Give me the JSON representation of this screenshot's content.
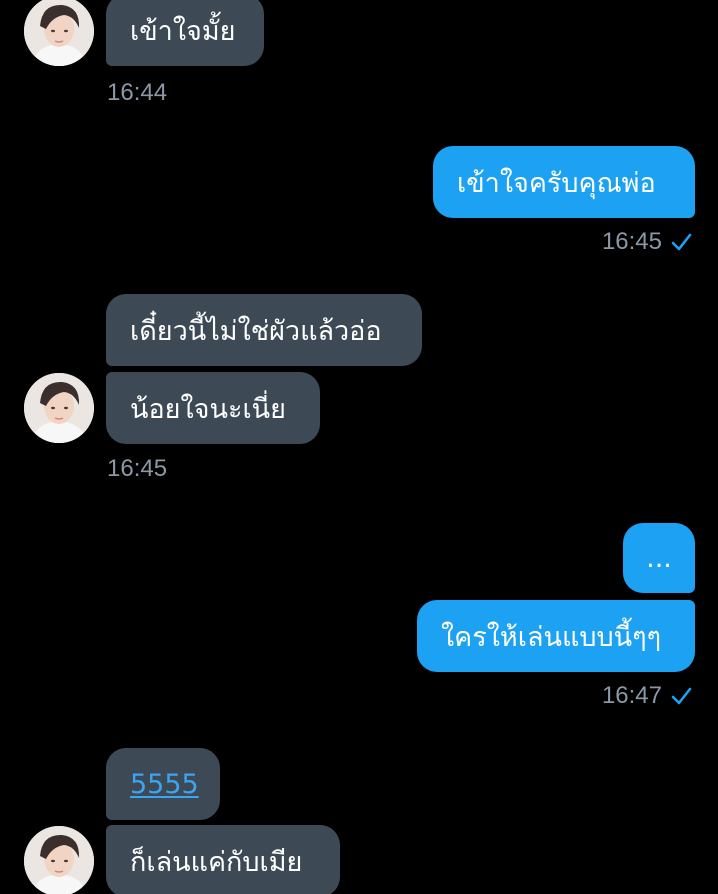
{
  "messages": [
    {
      "text": "เข้าใจมั้ย"
    },
    {
      "text": "เข้าใจครับคุณพ่อ"
    },
    {
      "text": "เดี๋ยวนี้ไม่ใช่ผัวแล้วอ่อ"
    },
    {
      "text": "น้อยใจนะเนี่ย"
    },
    {
      "text": "..."
    },
    {
      "text": "ใครให้เล่นแบบนี้ๆๆ"
    },
    {
      "text": "5555"
    },
    {
      "text": "ก็เล่นแค่กับเมีย"
    }
  ],
  "timestamps": {
    "t1": "16:44",
    "t2": "16:45",
    "t3": "16:45",
    "t4": "16:47"
  },
  "icons": {
    "sent": "checkmark-icon",
    "avatar": "profile-avatar"
  },
  "colors": {
    "background": "#000000",
    "incoming_bubble": "#3d4a56",
    "outgoing_bubble": "#1da1f2",
    "timestamp": "#8b98a5",
    "link": "#3aa5f0"
  }
}
